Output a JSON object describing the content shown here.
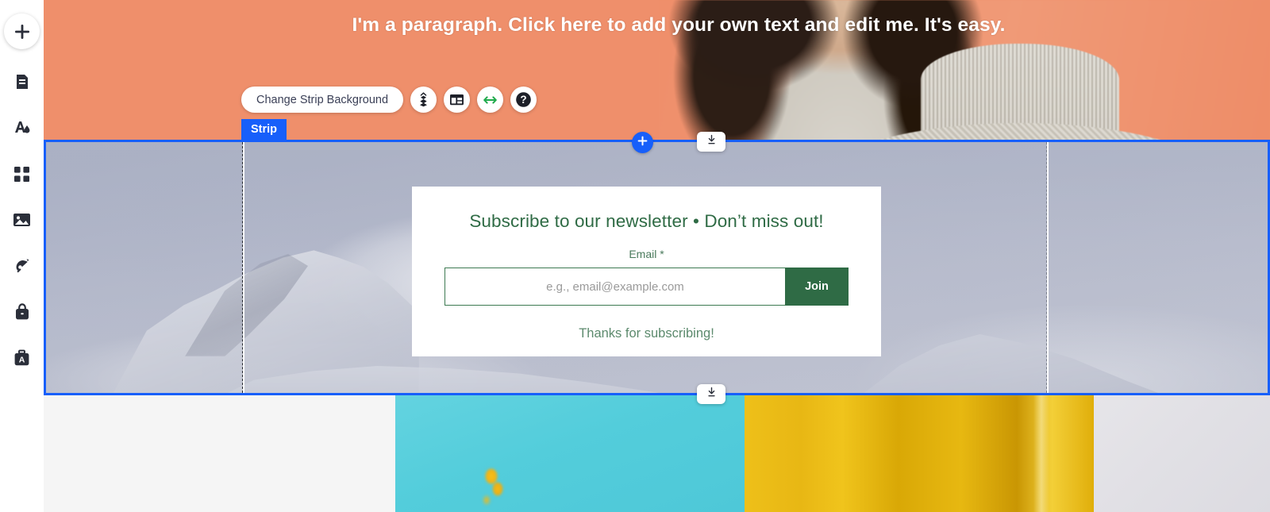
{
  "sidebar": {
    "items": [
      {
        "name": "add-element",
        "icon": "plus-icon"
      },
      {
        "name": "pages",
        "icon": "page-icon"
      },
      {
        "name": "site-design",
        "icon": "theme-design-icon"
      },
      {
        "name": "apps-market",
        "icon": "grid-apps-icon"
      },
      {
        "name": "media",
        "icon": "image-icon"
      },
      {
        "name": "blog",
        "icon": "pen-nib-icon"
      },
      {
        "name": "store",
        "icon": "shopping-bag-icon"
      },
      {
        "name": "my-business",
        "icon": "briefcase-a-icon"
      }
    ]
  },
  "hero": {
    "paragraph": "I'm a paragraph. Click here to add your own text and edit me. It's easy.",
    "background_color": "#ef8f6b"
  },
  "toolbar": {
    "change_background_label": "Change Strip Background",
    "buttons": [
      {
        "name": "animation-button",
        "icon": "layers-animation-icon"
      },
      {
        "name": "layout-button",
        "icon": "columns-layout-icon"
      },
      {
        "name": "stretch-button",
        "icon": "horizontal-arrows-icon",
        "color": "#1faa4b"
      },
      {
        "name": "help-button",
        "icon": "help-question-icon"
      }
    ]
  },
  "strip": {
    "tab_label": "Strip",
    "selection_color": "#175ffa",
    "add_section_icon": "plus-icon",
    "drag_handle_icon": "download-handle-icon"
  },
  "newsletter": {
    "title": "Subscribe to our newsletter • Don’t miss out!",
    "field_label": "Email *",
    "email_value": "",
    "email_placeholder": "e.g., email@example.com",
    "submit_label": "Join",
    "success_message": "Thanks for subscribing!",
    "accent_color": "#2f6b45"
  },
  "bottom_sections": [
    {
      "name": "section-light",
      "color": "#f5f5f5"
    },
    {
      "name": "section-cyan",
      "color": "#53cddb"
    },
    {
      "name": "section-gold",
      "color": "#e8b714"
    },
    {
      "name": "section-gray",
      "color": "#e1e0e5"
    }
  ]
}
